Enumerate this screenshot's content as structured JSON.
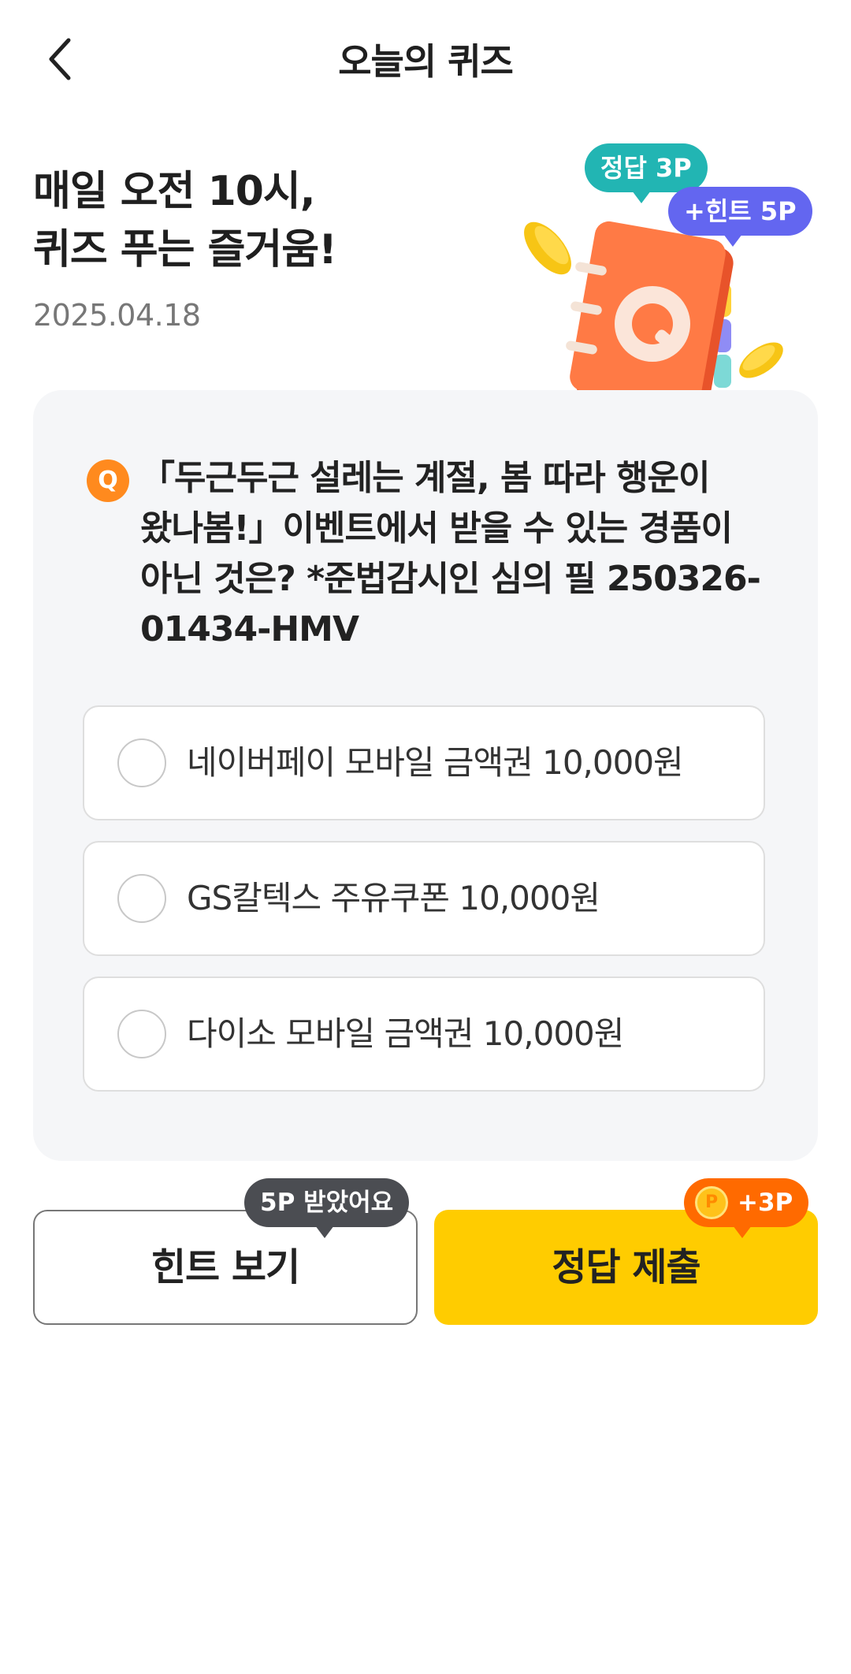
{
  "header": {
    "title": "오늘의 퀴즈",
    "back_icon": "chevron-left-icon"
  },
  "hero": {
    "title_line1": "매일 오전 10시,",
    "title_line2": "퀴즈 푸는 즐거움!",
    "date": "2025.04.18",
    "bubble_answer": "정답 3P",
    "bubble_hint": "+힌트 5P",
    "book_letter": "Q"
  },
  "quiz": {
    "badge": "Q",
    "question": "「두근두근 설레는 계절, 봄 따라 행운이 왔나봄!」이벤트에서 받을 수 있는 경품이 아닌 것은? *준법감시인 심의 필 250326-01434-HMV",
    "options": [
      {
        "label": "네이버페이 모바일 금액권 10,000원"
      },
      {
        "label": "GS칼텍스 주유쿠폰 10,000원"
      },
      {
        "label": "다이소 모바일 금액권 10,000원"
      }
    ]
  },
  "actions": {
    "hint_label": "힌트 보기",
    "hint_tip": "5P 받았어요",
    "submit_label": "정답 제출",
    "submit_tip": "+3P",
    "coin_symbol": "P"
  },
  "colors": {
    "accent_yellow": "#ffcc00",
    "answer_teal": "#22b5b3",
    "hint_purple": "#6366f0",
    "reward_orange": "#ff6a00",
    "q_badge_orange": "#ff8a1e"
  }
}
